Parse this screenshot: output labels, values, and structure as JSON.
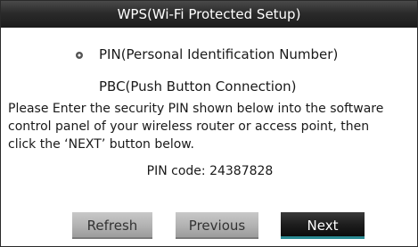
{
  "dialog": {
    "title": "WPS(Wi-Fi Protected Setup)"
  },
  "options": {
    "pin_label": "PIN(Personal Identification Number)",
    "pbc_label": "PBC(Push Button Connection)",
    "selected": "PIN(Personal Identification Number)"
  },
  "instructions": {
    "text": "Please Enter the security PIN shown below into the software\ncontrol panel of your wireless router or access point, then\nclick the ‘NEXT’ button below."
  },
  "pin": {
    "text": "PIN code: 24387828"
  },
  "buttons": {
    "refresh": "Refresh",
    "previous": "Previous",
    "next": "Next"
  },
  "colors": {
    "title_bar": "#2b2b2b",
    "button_gray": "#b4b4b4",
    "button_active": "#1e1e1e",
    "active_accent": "#2a8a92"
  }
}
